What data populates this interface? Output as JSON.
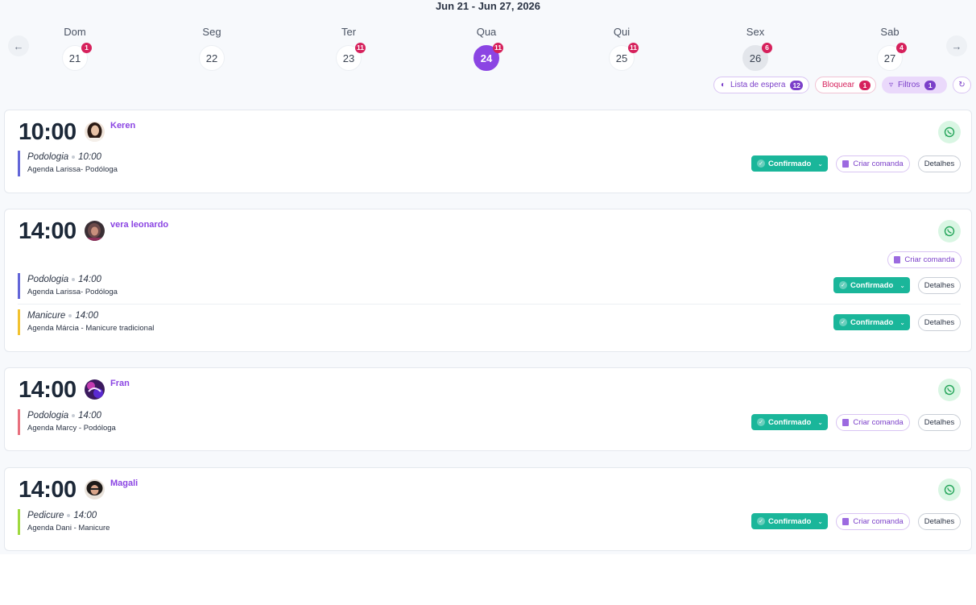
{
  "header": {
    "week_range": "Jun 21 - Jun 27, 2026"
  },
  "nav": {
    "prev_icon": "arrow-left-icon",
    "next_icon": "arrow-right-icon"
  },
  "days": [
    {
      "name": "Dom",
      "num": "21",
      "badge": "1"
    },
    {
      "name": "Seg",
      "num": "22",
      "badge": ""
    },
    {
      "name": "Ter",
      "num": "23",
      "badge": "11"
    },
    {
      "name": "Qua",
      "num": "24",
      "badge": "11",
      "selected": true
    },
    {
      "name": "Qui",
      "num": "25",
      "badge": "11"
    },
    {
      "name": "Sex",
      "num": "26",
      "badge": "6"
    },
    {
      "name": "Sab",
      "num": "27",
      "badge": "4"
    }
  ],
  "toolbar": {
    "waitlist_label": "Lista de espera",
    "waitlist_count": "12",
    "block_label": "Bloquear",
    "block_count": "1",
    "filters_label": "Filtros",
    "filters_count": "1"
  },
  "actions": {
    "status_label": "Confirmado",
    "comanda_label": "Criar comanda",
    "details_label": "Detalhes"
  },
  "colors": {
    "accent": "#8b45e3",
    "badge": "#d6215c",
    "status": "#1ab69a",
    "whatsapp": "#25a55a"
  },
  "appointments": [
    {
      "time": "10:00",
      "client": "Keren",
      "services": [
        {
          "name": "Podologia",
          "time": "10:00",
          "agenda": "Agenda Larissa- Podóloga",
          "color": "#6366d8"
        }
      ]
    },
    {
      "time": "14:00",
      "client": "vera leonardo",
      "services": [
        {
          "name": "Podologia",
          "time": "14:00",
          "agenda": "Agenda Larissa- Podóloga",
          "color": "#6366d8"
        },
        {
          "name": "Manicure",
          "time": "14:00",
          "agenda": "Agenda Márcia - Manicure tradicional",
          "color": "#f2c230"
        }
      ]
    },
    {
      "time": "14:00",
      "client": "Fran",
      "services": [
        {
          "name": "Podologia",
          "time": "14:00",
          "agenda": "Agenda Marcy - Podóloga",
          "color": "#e8707e"
        }
      ]
    },
    {
      "time": "14:00",
      "client": "Magali",
      "services": [
        {
          "name": "Pedicure",
          "time": "14:00",
          "agenda": "Agenda Dani - Manicure",
          "color": "#9fd93f"
        }
      ]
    }
  ]
}
